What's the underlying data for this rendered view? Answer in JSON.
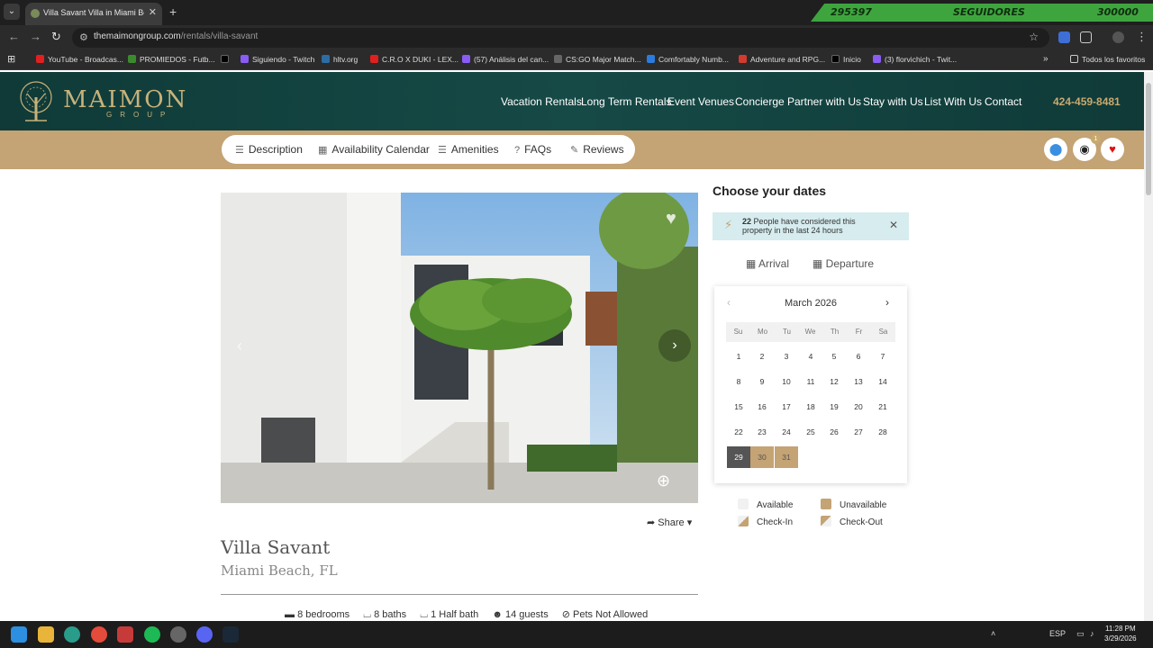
{
  "browser": {
    "tab_title": "Villa Savant Villa in Miami Beach",
    "url_host": "themaimongroup.com",
    "url_path": "/rentals/villa-savant",
    "stream_current": "295397",
    "stream_label": "SEGUIDORES",
    "stream_goal": "300000",
    "bookmarks": [
      "YouTube - Broadcas...",
      "PROMIEDOS - Futb...",
      "Siguiendo - Twitch",
      "hltv.org",
      "C.R.O X DUKI - LEX...",
      "(57) Análisis del can...",
      "CS:GO Major Match...",
      "Comfortably Numb...",
      "Adventure and RPG...",
      "Inicio",
      "(3) florvichich - Twit..."
    ],
    "bookmarks_folder": "Todos los favoritos"
  },
  "site": {
    "logo_word": "MAIMON",
    "logo_sub": "GROUP",
    "nav": [
      "Vacation Rentals",
      "Long Term Rentals",
      "Event Venues",
      "Concierge",
      "Partner with Us",
      "Stay with Us",
      "List With Us",
      "Contact"
    ],
    "phone": "424-459-8481",
    "subnav": [
      "Description",
      "Availability Calendar",
      "Amenities",
      "FAQs",
      "Reviews"
    ],
    "badge_count": "1"
  },
  "listing": {
    "share": "Share",
    "title": "Villa Savant",
    "location": "Miami Beach, FL",
    "features": [
      "8 bedrooms",
      "8 baths",
      "1 Half bath",
      "14 guests",
      "Pets Not Allowed"
    ]
  },
  "booking": {
    "heading": "Choose your dates",
    "notice_count": "22",
    "notice_text": "People have considered this property in the last 24 hours",
    "arrival": "Arrival",
    "departure": "Departure",
    "month": "March 2026",
    "dow": [
      "Su",
      "Mo",
      "Tu",
      "We",
      "Th",
      "Fr",
      "Sa"
    ],
    "days": [
      "1",
      "2",
      "3",
      "4",
      "5",
      "6",
      "7",
      "8",
      "9",
      "10",
      "11",
      "12",
      "13",
      "14",
      "15",
      "16",
      "17",
      "18",
      "19",
      "20",
      "21",
      "22",
      "23",
      "24",
      "25",
      "26",
      "27",
      "28",
      "29",
      "30",
      "31"
    ],
    "legend": [
      "Available",
      "Unavailable",
      "Check-In",
      "Check-Out"
    ]
  },
  "taskbar": {
    "lang": "ESP",
    "time": "11:28 PM",
    "date": "3/29/2026"
  }
}
